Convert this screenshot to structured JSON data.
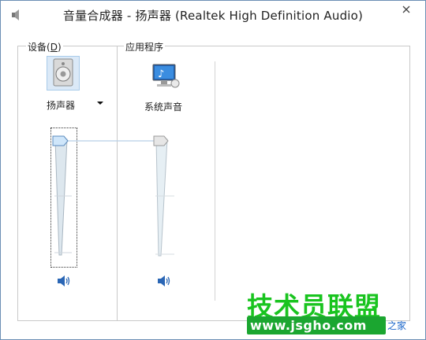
{
  "window": {
    "title": "音量合成器 - 扬声器 (Realtek High Definition Audio)"
  },
  "device_group": {
    "label_prefix": "设备(",
    "label_accel": "D",
    "label_suffix": ")",
    "device_name": "扬声器",
    "volume_level": 1.0,
    "icon": "speaker-icon"
  },
  "apps_group": {
    "label": "应用程序",
    "apps": [
      {
        "name": "系统声音",
        "volume_level": 1.0,
        "icon": "system-sounds-icon"
      }
    ]
  },
  "watermark": {
    "brand": "技术员联盟",
    "url": "www.jsgho.com",
    "tag": "之家"
  },
  "colors": {
    "brand_green": "#19c41f",
    "frame_border": "#6b8fb5",
    "slider_track": "#dfe8ef",
    "thumb_device": "#cfe6fa",
    "thumb_app": "#e6e6e6"
  }
}
